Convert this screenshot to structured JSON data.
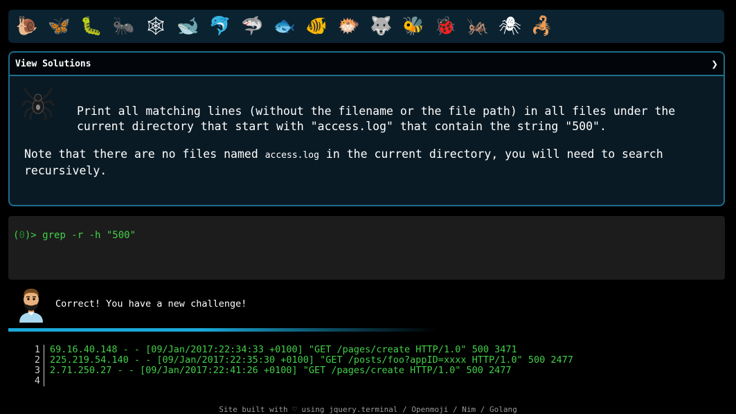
{
  "emoji_bar": {
    "items": [
      {
        "name": "snail-icon",
        "glyph": "🐌"
      },
      {
        "name": "butterfly-icon",
        "glyph": "🦋"
      },
      {
        "name": "caterpillar-icon",
        "glyph": "🐛"
      },
      {
        "name": "ant-icon",
        "glyph": "🐜"
      },
      {
        "name": "spider-web-icon",
        "glyph": "🕸"
      },
      {
        "name": "whale-icon",
        "glyph": "🐋"
      },
      {
        "name": "dolphin-icon",
        "glyph": "🐬"
      },
      {
        "name": "shark-icon",
        "glyph": "🦈"
      },
      {
        "name": "fish-icon",
        "glyph": "🐟"
      },
      {
        "name": "tropical-fish-icon",
        "glyph": "🐠"
      },
      {
        "name": "blowfish-icon",
        "glyph": "🐡"
      },
      {
        "name": "wolf-icon",
        "glyph": "🐺"
      },
      {
        "name": "bee-icon",
        "glyph": "🐝"
      },
      {
        "name": "ladybug-icon",
        "glyph": "🐞"
      },
      {
        "name": "cricket-icon",
        "glyph": "🦗"
      },
      {
        "name": "spider-icon",
        "glyph": "🕷"
      },
      {
        "name": "scorpion-icon",
        "glyph": "🦂"
      }
    ]
  },
  "panel": {
    "title": "View Solutions",
    "chevron": "❯",
    "description": "Print all matching lines (without the filename or the file path) in all files under the current directory that start with \"access.log\" that contain the string \"500\".",
    "note_before": "Note that there are no files named ",
    "note_code": "access.log",
    "note_after": " in the current directory, you will need to search recursively."
  },
  "terminal": {
    "prompt_open": "(",
    "prompt_num": "0",
    "prompt_close": ")>",
    "command": " grep -r -h \"500\""
  },
  "feedback": {
    "message": "Correct! You have a new challenge!"
  },
  "output": {
    "lines": [
      {
        "n": "1",
        "text": "69.16.40.148 - - [09/Jan/2017:22:34:33 +0100] \"GET /pages/create HTTP/1.0\" 500 3471"
      },
      {
        "n": "2",
        "text": "225.219.54.140 - - [09/Jan/2017:22:35:30 +0100] \"GET /posts/foo?appID=xxxx HTTP/1.0\" 500 2477"
      },
      {
        "n": "3",
        "text": "2.71.250.27 - - [09/Jan/2017:22:41:26 +0100] \"GET /pages/create HTTP/1.0\" 500 2477"
      },
      {
        "n": "4",
        "text": ""
      }
    ]
  },
  "footer": {
    "prefix": "Site built with ♡ using ",
    "links": [
      "jquery.terminal",
      "Openmoji",
      "Nim",
      "Golang"
    ],
    "sep": " / "
  },
  "colors": {
    "accent": "#1e6d8c",
    "terminal_green": "#43d04a",
    "progress_bar": "#1aa8d8"
  }
}
